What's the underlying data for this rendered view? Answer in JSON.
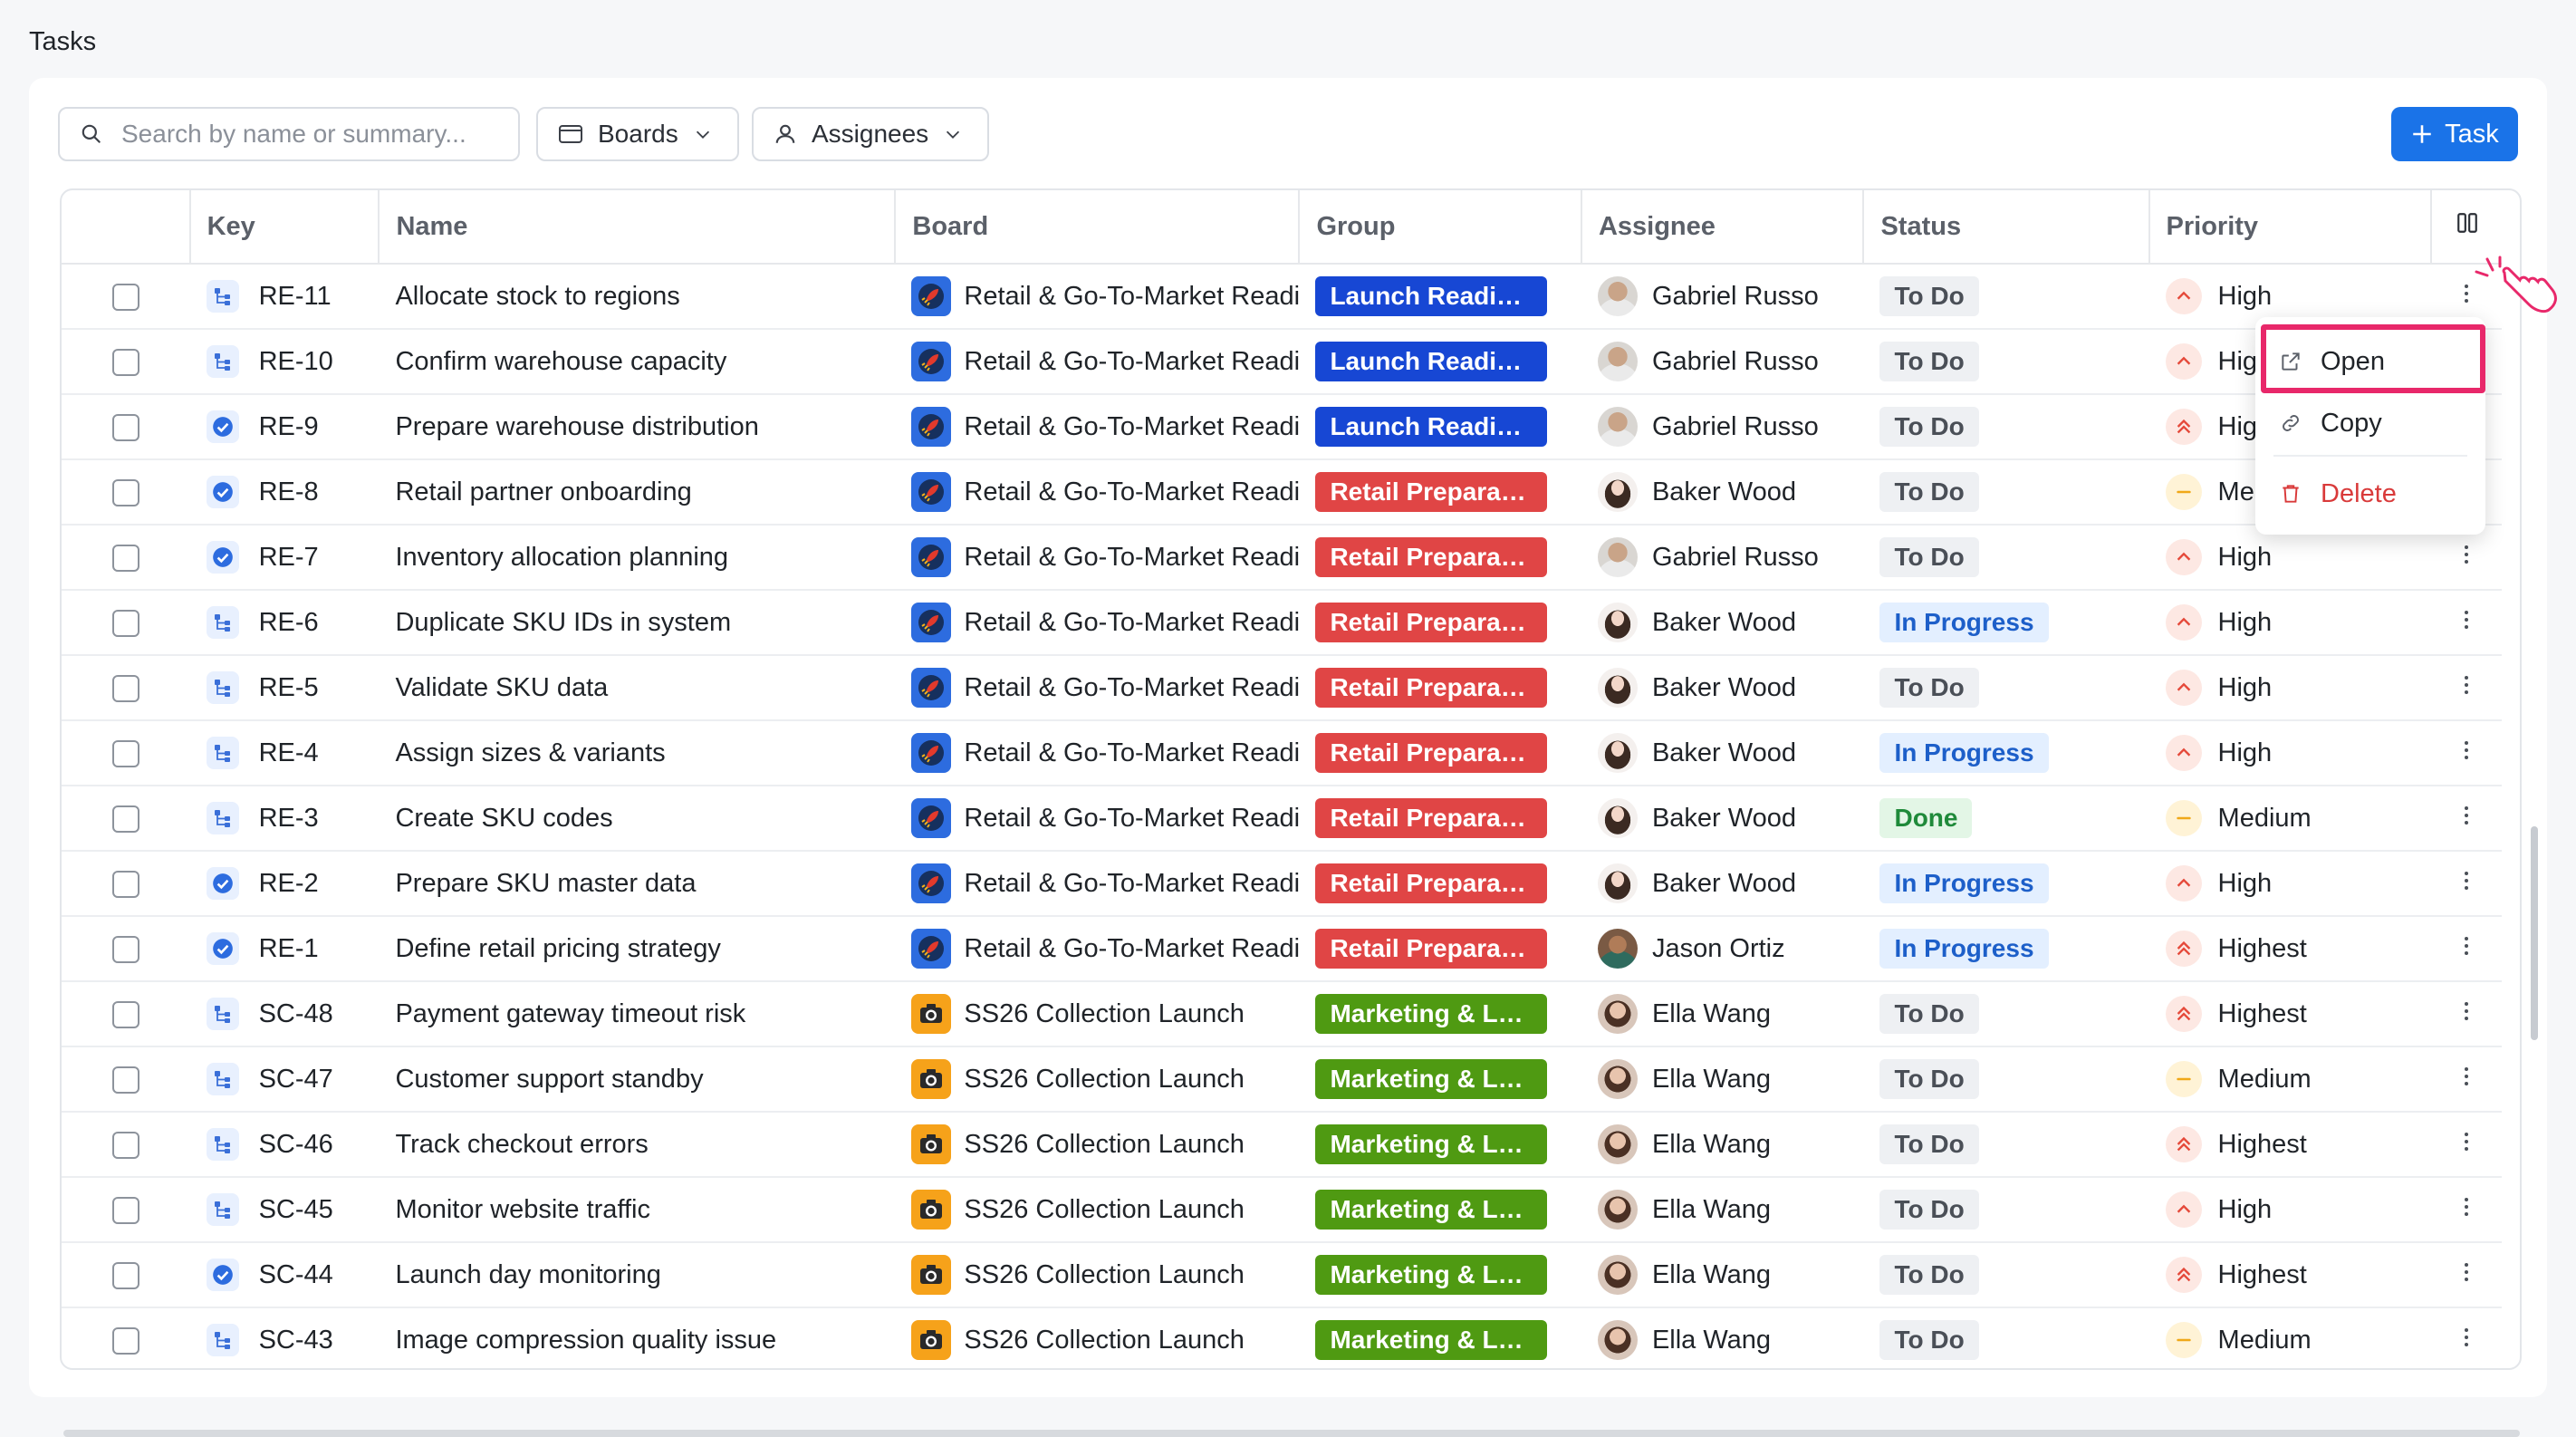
{
  "page": {
    "title": "Tasks"
  },
  "toolbar": {
    "search_placeholder": "Search by name or summary...",
    "boards_label": "Boards",
    "assignees_label": "Assignees",
    "add_task_label": "Task"
  },
  "table": {
    "columns": {
      "key": "Key",
      "name": "Name",
      "board": "Board",
      "group": "Group",
      "assignee": "Assignee",
      "status": "Status",
      "priority": "Priority"
    },
    "rows": [
      {
        "key": "RE-11",
        "type": "subtask",
        "name": "Allocate stock to regions",
        "board": "Retail & Go-To-Market Readiness",
        "board_icon": "retail",
        "group": "Launch Readiness",
        "group_color": "#1747d4",
        "assignee": "Gabriel Russo",
        "status": "To Do",
        "status_kind": "todo",
        "priority": "High",
        "priority_kind": "high"
      },
      {
        "key": "RE-10",
        "type": "subtask",
        "name": "Confirm warehouse capacity",
        "board": "Retail & Go-To-Market Readiness",
        "board_icon": "retail",
        "group": "Launch Readiness",
        "group_color": "#1747d4",
        "assignee": "Gabriel Russo",
        "status": "To Do",
        "status_kind": "todo",
        "priority": "High",
        "priority_kind": "high"
      },
      {
        "key": "RE-9",
        "type": "task",
        "name": "Prepare warehouse distribution",
        "board": "Retail & Go-To-Market Readiness",
        "board_icon": "retail",
        "group": "Launch Readiness",
        "group_color": "#1747d4",
        "assignee": "Gabriel Russo",
        "status": "To Do",
        "status_kind": "todo",
        "priority": "Highest",
        "priority_kind": "highest"
      },
      {
        "key": "RE-8",
        "type": "task",
        "name": "Retail partner onboarding",
        "board": "Retail & Go-To-Market Readiness",
        "board_icon": "retail",
        "group": "Retail Preparation",
        "group_color": "#e04545",
        "assignee": "Baker Wood",
        "status": "To Do",
        "status_kind": "todo",
        "priority": "Medium",
        "priority_kind": "medium"
      },
      {
        "key": "RE-7",
        "type": "task",
        "name": "Inventory allocation planning",
        "board": "Retail & Go-To-Market Readiness",
        "board_icon": "retail",
        "group": "Retail Preparation",
        "group_color": "#e04545",
        "assignee": "Gabriel Russo",
        "status": "To Do",
        "status_kind": "todo",
        "priority": "High",
        "priority_kind": "high"
      },
      {
        "key": "RE-6",
        "type": "subtask",
        "name": "Duplicate SKU IDs in system",
        "board": "Retail & Go-To-Market Readiness",
        "board_icon": "retail",
        "group": "Retail Preparation",
        "group_color": "#e04545",
        "assignee": "Baker Wood",
        "status": "In Progress",
        "status_kind": "inprogress",
        "priority": "High",
        "priority_kind": "high"
      },
      {
        "key": "RE-5",
        "type": "subtask",
        "name": "Validate SKU data",
        "board": "Retail & Go-To-Market Readiness",
        "board_icon": "retail",
        "group": "Retail Preparation",
        "group_color": "#e04545",
        "assignee": "Baker Wood",
        "status": "To Do",
        "status_kind": "todo",
        "priority": "High",
        "priority_kind": "high"
      },
      {
        "key": "RE-4",
        "type": "subtask",
        "name": "Assign sizes & variants",
        "board": "Retail & Go-To-Market Readiness",
        "board_icon": "retail",
        "group": "Retail Preparation",
        "group_color": "#e04545",
        "assignee": "Baker Wood",
        "status": "In Progress",
        "status_kind": "inprogress",
        "priority": "High",
        "priority_kind": "high"
      },
      {
        "key": "RE-3",
        "type": "subtask",
        "name": "Create SKU codes",
        "board": "Retail & Go-To-Market Readiness",
        "board_icon": "retail",
        "group": "Retail Preparation",
        "group_color": "#e04545",
        "assignee": "Baker Wood",
        "status": "Done",
        "status_kind": "done",
        "priority": "Medium",
        "priority_kind": "medium"
      },
      {
        "key": "RE-2",
        "type": "task",
        "name": "Prepare SKU master data",
        "board": "Retail & Go-To-Market Readiness",
        "board_icon": "retail",
        "group": "Retail Preparation",
        "group_color": "#e04545",
        "assignee": "Baker Wood",
        "status": "In Progress",
        "status_kind": "inprogress",
        "priority": "High",
        "priority_kind": "high"
      },
      {
        "key": "RE-1",
        "type": "task",
        "name": "Define retail pricing strategy",
        "board": "Retail & Go-To-Market Readiness",
        "board_icon": "retail",
        "group": "Retail Preparation",
        "group_color": "#e04545",
        "assignee": "Jason Ortiz",
        "status": "In Progress",
        "status_kind": "inprogress",
        "priority": "Highest",
        "priority_kind": "highest"
      },
      {
        "key": "SC-48",
        "type": "subtask",
        "name": "Payment gateway timeout risk",
        "board": "SS26 Collection Launch",
        "board_icon": "ss26",
        "group": "Marketing & Launch",
        "group_color": "#4f9a12",
        "assignee": "Ella Wang",
        "status": "To Do",
        "status_kind": "todo",
        "priority": "Highest",
        "priority_kind": "highest"
      },
      {
        "key": "SC-47",
        "type": "subtask",
        "name": "Customer support standby",
        "board": "SS26 Collection Launch",
        "board_icon": "ss26",
        "group": "Marketing & Launch",
        "group_color": "#4f9a12",
        "assignee": "Ella Wang",
        "status": "To Do",
        "status_kind": "todo",
        "priority": "Medium",
        "priority_kind": "medium"
      },
      {
        "key": "SC-46",
        "type": "subtask",
        "name": "Track checkout errors",
        "board": "SS26 Collection Launch",
        "board_icon": "ss26",
        "group": "Marketing & Launch",
        "group_color": "#4f9a12",
        "assignee": "Ella Wang",
        "status": "To Do",
        "status_kind": "todo",
        "priority": "Highest",
        "priority_kind": "highest"
      },
      {
        "key": "SC-45",
        "type": "subtask",
        "name": "Monitor website traffic",
        "board": "SS26 Collection Launch",
        "board_icon": "ss26",
        "group": "Marketing & Launch",
        "group_color": "#4f9a12",
        "assignee": "Ella Wang",
        "status": "To Do",
        "status_kind": "todo",
        "priority": "High",
        "priority_kind": "high"
      },
      {
        "key": "SC-44",
        "type": "task",
        "name": "Launch day monitoring",
        "board": "SS26 Collection Launch",
        "board_icon": "ss26",
        "group": "Marketing & Launch",
        "group_color": "#4f9a12",
        "assignee": "Ella Wang",
        "status": "To Do",
        "status_kind": "todo",
        "priority": "Highest",
        "priority_kind": "highest"
      },
      {
        "key": "SC-43",
        "type": "subtask",
        "name": "Image compression quality issue",
        "board": "SS26 Collection Launch",
        "board_icon": "ss26",
        "group": "Marketing & Launch",
        "group_color": "#4f9a12",
        "assignee": "Ella Wang",
        "status": "To Do",
        "status_kind": "todo",
        "priority": "Medium",
        "priority_kind": "medium"
      }
    ]
  },
  "context_menu": {
    "open_label": "Open",
    "copy_label": "Copy",
    "delete_label": "Delete"
  },
  "colors": {
    "accent": "#1a73e8",
    "highlight": "#e8286a",
    "delete": "#d93a3a"
  }
}
